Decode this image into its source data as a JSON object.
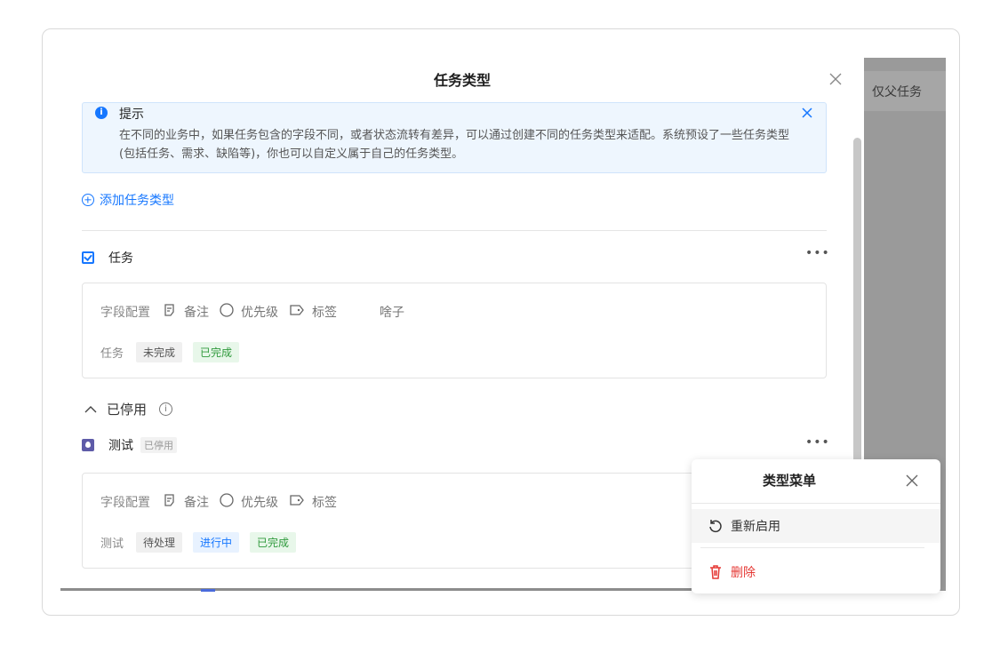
{
  "background": {
    "column_header": "仅父任务"
  },
  "modal": {
    "title": "任务类型",
    "notice": {
      "title": "提示",
      "body": "在不同的业务中，如果任务包含的字段不同，或者状态流转有差异，可以通过创建不同的任务类型来适配。系统预设了一些任务类型 (包括任务、需求、缺陷等)，你也可以自定义属于自己的任务类型。"
    },
    "add_type_label": "添加任务类型",
    "types": [
      {
        "name": "任务",
        "fields_label": "字段配置",
        "fields": [
          "备注",
          "优先级",
          "标签",
          "啥子"
        ],
        "status_label": "任务",
        "statuses": [
          "未完成",
          "已完成"
        ]
      }
    ],
    "disabled_section": {
      "label": "已停用",
      "types": [
        {
          "name": "测试",
          "badge": "已停用",
          "fields_label": "字段配置",
          "fields": [
            "备注",
            "优先级",
            "标签"
          ],
          "status_label": "测试",
          "statuses": [
            "待处理",
            "进行中",
            "已完成"
          ]
        }
      ]
    }
  },
  "popup": {
    "title": "类型菜单",
    "items": [
      "重新启用",
      "删除"
    ]
  },
  "colors": {
    "accent": "#1677ff",
    "danger": "#e53935",
    "success": "#2f9a3c"
  }
}
